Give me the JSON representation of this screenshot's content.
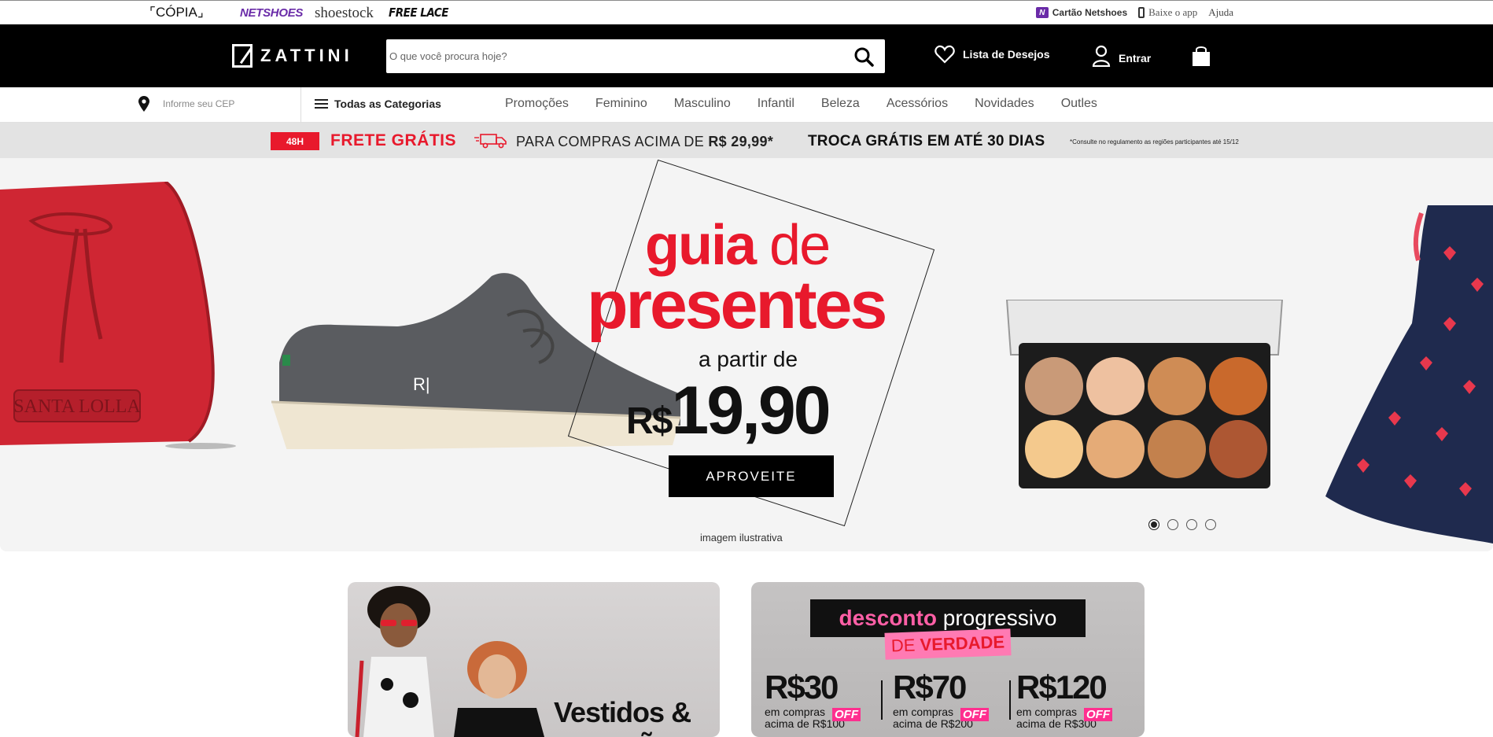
{
  "topbar": {
    "copy_label": "CÓPIA",
    "brands": [
      "NETSHOES",
      "shoestock",
      "FREE LACE"
    ],
    "cartao": "Cartão Netshoes",
    "app": "Baixe o app",
    "help": "Ajuda"
  },
  "header": {
    "logo": "ZATTINI",
    "search_placeholder": "O que você procura hoje?",
    "wishlist": "Lista de Desejos",
    "login": "Entrar"
  },
  "nav": {
    "cep_placeholder": "Informe seu CEP",
    "all_categories": "Todas as Categorias",
    "links": [
      "Promoções",
      "Feminino",
      "Masculino",
      "Infantil",
      "Beleza",
      "Acessórios",
      "Novidades",
      "Outles"
    ]
  },
  "promo": {
    "badge": "48H",
    "frete": "FRETE GRÁTIS",
    "para": "PARA COMPRAS ACIMA DE",
    "para_value": "R$ 29,99*",
    "troca": "TROCA GRÁTIS EM ATÉ 30 DIAS",
    "consulte": "*Consulte no regulamento as regiões participantes até 15/12"
  },
  "hero": {
    "guia": "guia",
    "de": "de",
    "presentes": "presentes",
    "a_partir": "a partir de",
    "currency": "R$",
    "price": "19,90",
    "cta": "APROVEITE",
    "note": "imagem ilustrativa",
    "bag_text": "SANTA LOLLA",
    "shoe_text": "R|",
    "slides_total": 4,
    "slide_active": 1
  },
  "cards": {
    "left_title_1": "Vestidos &",
    "left_title_2": "macacões",
    "right_heading_a": "desconto",
    "right_heading_b": "progressivo",
    "right_sub_a": "DE",
    "right_sub_b": "VERDADE",
    "tiers": [
      {
        "value": "R$30",
        "line1": "em compras",
        "line2": "acima de R$100",
        "off": "OFF"
      },
      {
        "value": "R$70",
        "line1": "em compras",
        "line2": "acima de R$200",
        "off": "OFF"
      },
      {
        "value": "R$120",
        "line1": "em compras",
        "line2": "acima de R$300",
        "off": "OFF"
      }
    ]
  },
  "colors": {
    "brand_red": "#e8192c",
    "netshoes_purple": "#6a2ba8",
    "pink": "#ff2f8f"
  }
}
